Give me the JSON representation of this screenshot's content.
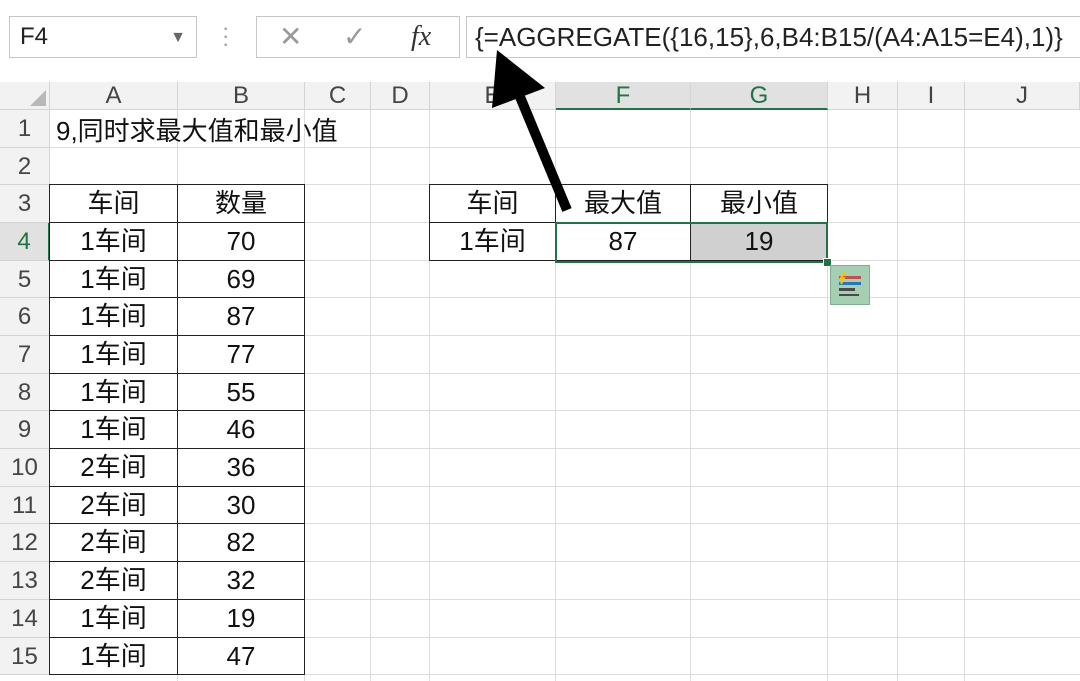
{
  "name_box": {
    "value": "F4"
  },
  "formula_bar": {
    "cancel_glyph": "✕",
    "enter_glyph": "✓",
    "fx_label": "fx",
    "formula": "{=AGGREGATE({16,15},6,B4:B15/(A4:A15=E4),1)}"
  },
  "columns": [
    "A",
    "B",
    "C",
    "D",
    "E",
    "F",
    "G",
    "H",
    "I",
    "J"
  ],
  "selected_columns": [
    "F",
    "G"
  ],
  "rows": [
    "1",
    "2",
    "3",
    "4",
    "5",
    "6",
    "7",
    "8",
    "9",
    "10",
    "11",
    "12",
    "13",
    "14",
    "15"
  ],
  "selected_row": "4",
  "sheet": {
    "title": "9,同时求最大值和最小值",
    "table1": {
      "headers": [
        "车间",
        "数量"
      ],
      "rows": [
        [
          "1车间",
          "70"
        ],
        [
          "1车间",
          "69"
        ],
        [
          "1车间",
          "87"
        ],
        [
          "1车间",
          "77"
        ],
        [
          "1车间",
          "55"
        ],
        [
          "1车间",
          "46"
        ],
        [
          "2车间",
          "36"
        ],
        [
          "2车间",
          "30"
        ],
        [
          "2车间",
          "82"
        ],
        [
          "2车间",
          "32"
        ],
        [
          "1车间",
          "19"
        ],
        [
          "1车间",
          "47"
        ]
      ]
    },
    "table2": {
      "headers": [
        "车间",
        "最大值",
        "最小值"
      ],
      "row": [
        "1车间",
        "87",
        "19"
      ]
    }
  },
  "annotation": {
    "type": "arrow",
    "color": "#000000",
    "points_to": "formula-bar"
  },
  "colors": {
    "accent": "#217346",
    "selection_fill": "#d0d0d0"
  }
}
